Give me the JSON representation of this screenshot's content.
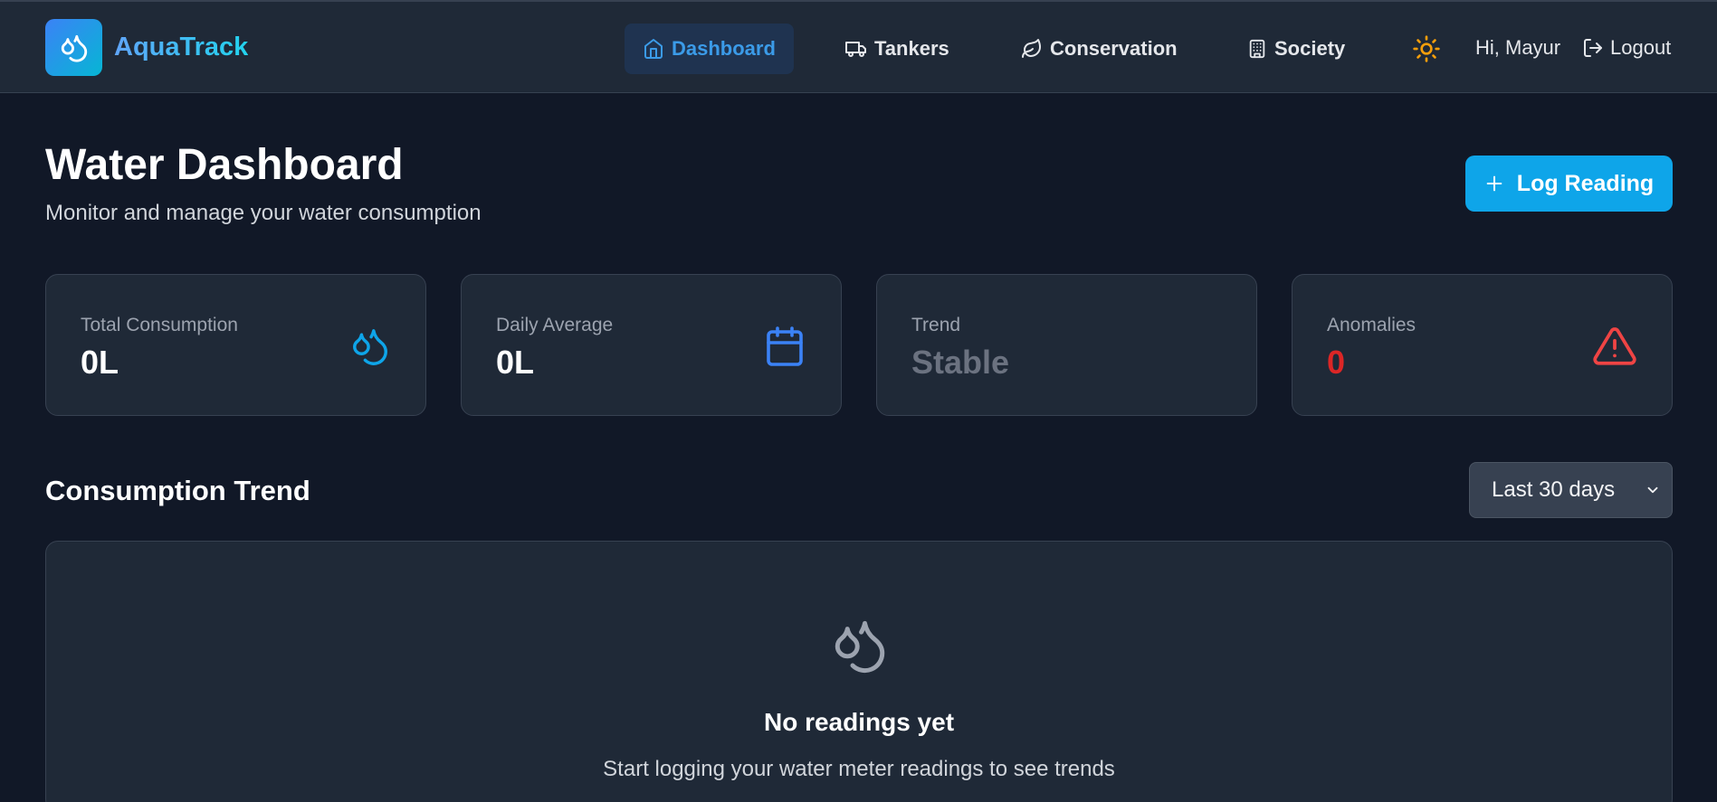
{
  "app": {
    "name": "AquaTrack",
    "logo_icon": "droplets-icon"
  },
  "nav": {
    "items": [
      {
        "label": "Dashboard",
        "icon": "home-icon",
        "active": true
      },
      {
        "label": "Tankers",
        "icon": "truck-icon",
        "active": false
      },
      {
        "label": "Conservation",
        "icon": "leaf-icon",
        "active": false
      },
      {
        "label": "Society",
        "icon": "building-icon",
        "active": false
      }
    ],
    "theme_icon": "sun-icon",
    "greeting": "Hi, Mayur",
    "logout_label": "Logout"
  },
  "page": {
    "title": "Water Dashboard",
    "subtitle": "Monitor and manage your water consumption",
    "log_button": "Log Reading"
  },
  "stats": [
    {
      "label": "Total Consumption",
      "value": "0L",
      "icon": "droplets-icon",
      "value_color": "#ffffff"
    },
    {
      "label": "Daily Average",
      "value": "0L",
      "icon": "calendar-icon",
      "value_color": "#ffffff"
    },
    {
      "label": "Trend",
      "value": "Stable",
      "icon": "",
      "value_color": "#6b7280"
    },
    {
      "label": "Anomalies",
      "value": "0",
      "icon": "alert-triangle-icon",
      "value_color": "#dc2626"
    }
  ],
  "trend": {
    "title": "Consumption Trend",
    "range_selected": "Last 30 days",
    "empty_title": "No readings yet",
    "empty_desc": "Start logging your water meter readings to see trends"
  },
  "colors": {
    "accent": "#0ea5e9",
    "background": "#111827",
    "card": "#1f2937",
    "danger": "#dc2626",
    "sun": "#f59e0b"
  }
}
